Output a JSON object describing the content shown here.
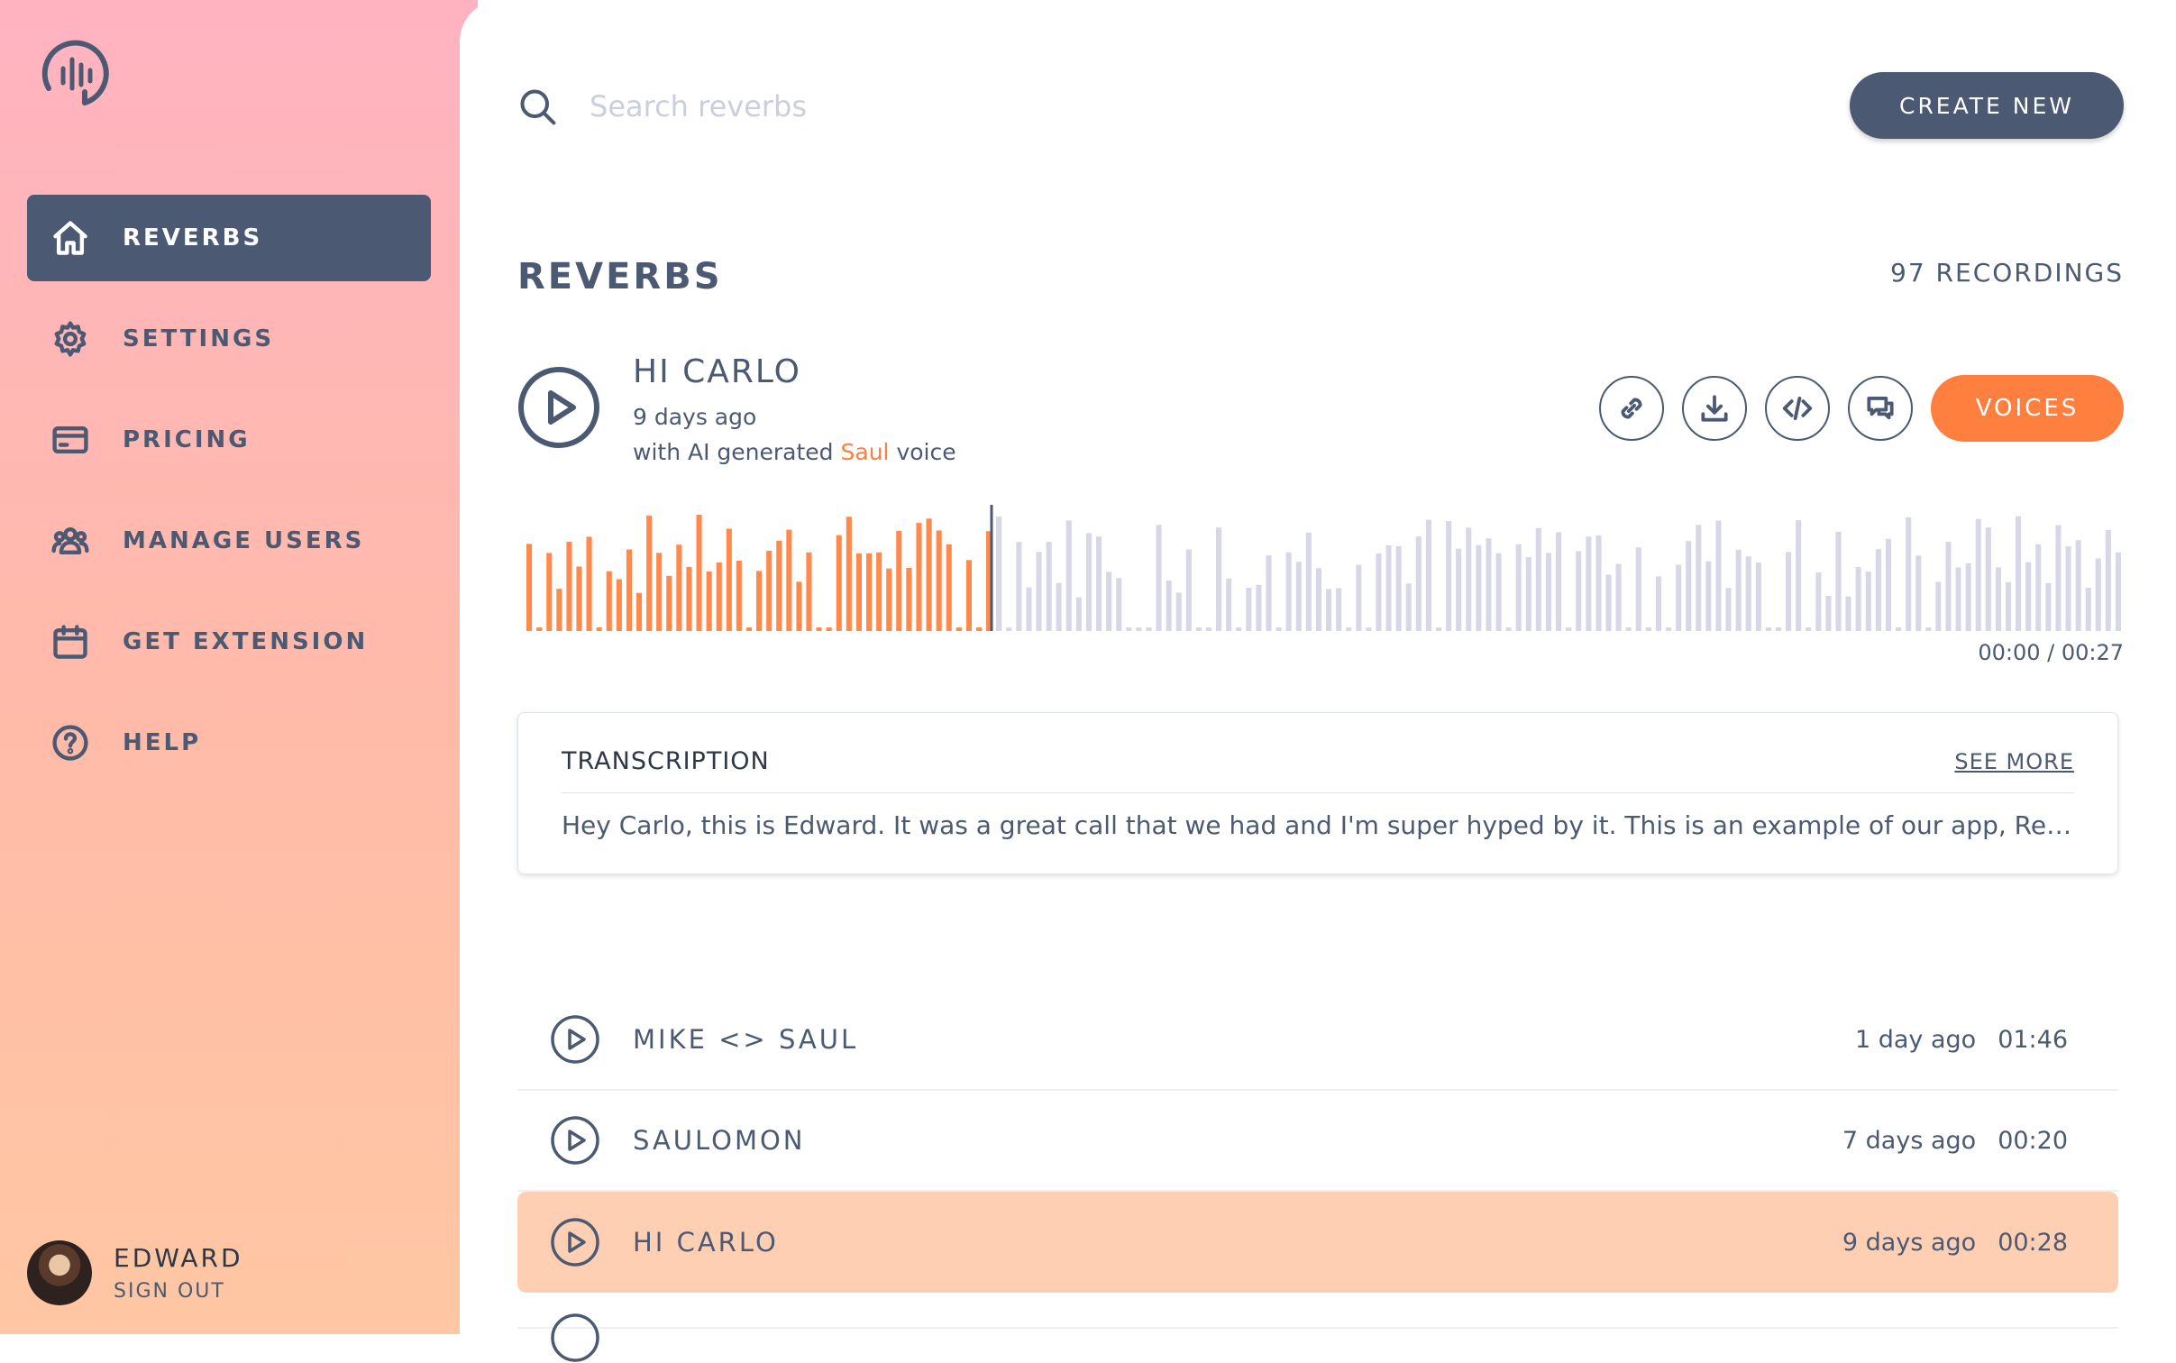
{
  "sidebar": {
    "items": [
      {
        "label": "REVERBS",
        "icon": "home-icon",
        "active": true
      },
      {
        "label": "SETTINGS",
        "icon": "gear-icon",
        "active": false
      },
      {
        "label": "PRICING",
        "icon": "credit-card-icon",
        "active": false
      },
      {
        "label": "MANAGE USERS",
        "icon": "users-icon",
        "active": false
      },
      {
        "label": "GET EXTENSION",
        "icon": "calendar-icon",
        "active": false
      },
      {
        "label": "HELP",
        "icon": "help-circle-icon",
        "active": false
      }
    ],
    "user": {
      "name": "EDWARD",
      "sign_out": "SIGN OUT"
    }
  },
  "header": {
    "search_placeholder": "Search reverbs",
    "create_label": "CREATE NEW"
  },
  "page": {
    "title": "REVERBS",
    "count": "97 RECORDINGS"
  },
  "player": {
    "title": "HI CARLO",
    "date": "9 days ago",
    "voice_prefix": "with AI generated",
    "voice_name": "Saul",
    "voice_suffix": "voice",
    "voices_label": "VOICES",
    "time": "00:00 / 00:27",
    "progress": 0.29
  },
  "transcription": {
    "title": "TRANSCRIPTION",
    "see_more": "SEE MORE",
    "text": "Hey Carlo, this is Edward. It was a great call that we had and I'm super hyped by it. This is an example of our app, Reverbs, and how it can generate voice messages with AI generated voices."
  },
  "recordings": [
    {
      "title": "MIKE <> SAUL",
      "ago": "1 day ago",
      "duration": "01:46",
      "selected": false
    },
    {
      "title": "SAULOMON",
      "ago": "7 days ago",
      "duration": "00:20",
      "selected": false
    },
    {
      "title": "HI CARLO",
      "ago": "9 days ago",
      "duration": "00:28",
      "selected": true
    }
  ],
  "colors": {
    "accent": "#ff7f3f",
    "primary": "#4b5a72",
    "played": "#ff8a4c",
    "unplayed": "#d8d7e8",
    "selected_row": "#ffcfb4"
  }
}
